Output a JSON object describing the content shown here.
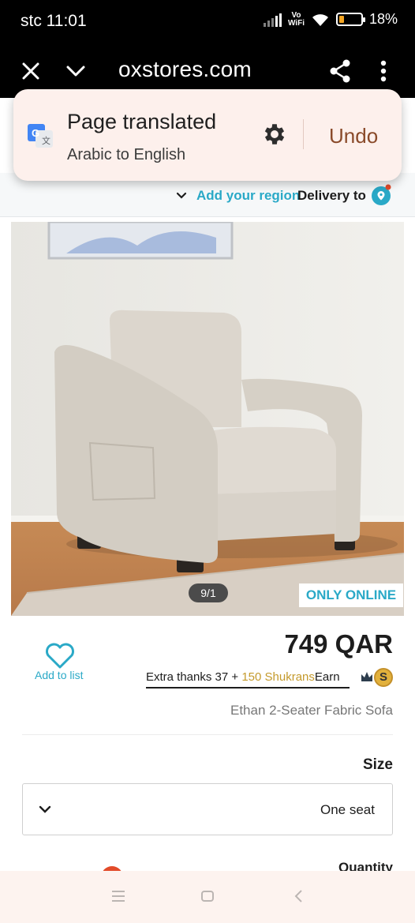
{
  "status_bar": {
    "carrier_time": "stc 11:01",
    "network_label_top": "Vo",
    "network_label_bottom": "WiFi",
    "battery_percent": "18%",
    "battery_level": 0.18
  },
  "browser": {
    "url": "oxstores.com",
    "close_icon": "close-icon",
    "menu_icon": "chevron-down-icon",
    "share_icon": "share-icon",
    "more_icon": "more-vert-icon"
  },
  "translate_popup": {
    "title": "Page translated",
    "subtitle": "Arabic to English",
    "undo_label": "Undo",
    "settings_icon": "gear-icon",
    "logo_icon": "google-translate-icon"
  },
  "region_bar": {
    "add_region": "Add your region",
    "delivery_to": "Delivery to"
  },
  "product": {
    "image_counter": "9/1",
    "badge": "ONLY ONLINE",
    "add_to_list": "Add to list",
    "price": "749 QAR",
    "shukran_text_before": "Extra thanks 37 + ",
    "shukran_points": "150 Shukrans",
    "shukran_text_after": "Earn",
    "coin_letter": "S",
    "name": "Ethan 2-Seater Fabric Sofa",
    "size_label": "Size",
    "size_value": "One seat",
    "quantity_label": "Quantity"
  },
  "colors": {
    "accent": "#2aa9c7",
    "undo": "#8a4a2a",
    "gold": "#c49a2c",
    "alert": "#e24b2a"
  }
}
